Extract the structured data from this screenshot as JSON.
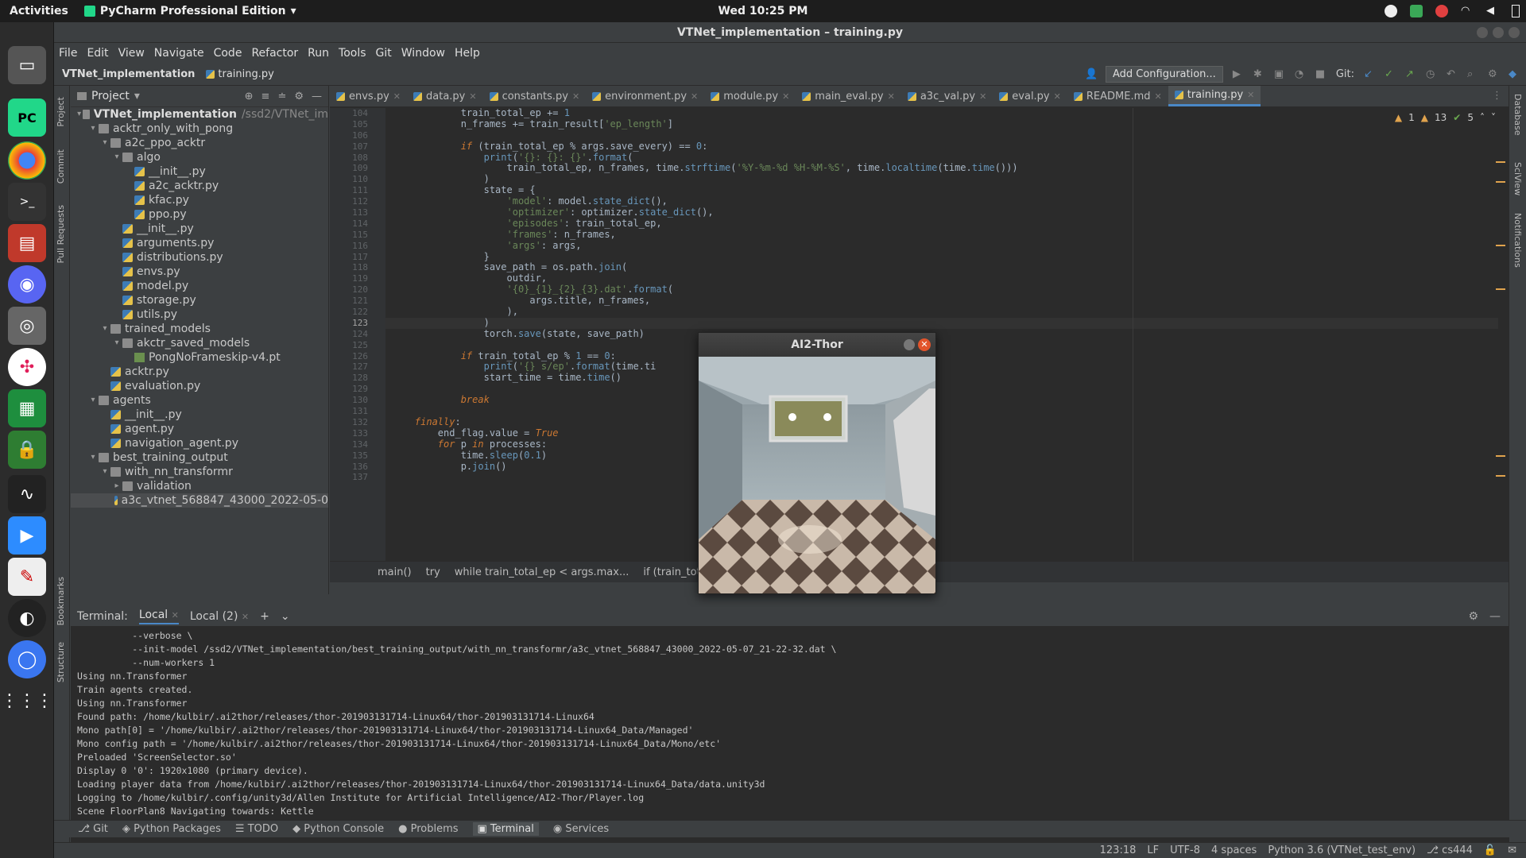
{
  "topbar": {
    "activities": "Activities",
    "app_name": "PyCharm Professional Edition",
    "clock": "Wed 10:25 PM"
  },
  "window": {
    "title": "VTNet_implementation – training.py"
  },
  "menu": [
    "File",
    "Edit",
    "View",
    "Navigate",
    "Code",
    "Refactor",
    "Run",
    "Tools",
    "Git",
    "Window",
    "Help"
  ],
  "navbar": {
    "project": "VTNet_implementation",
    "file": "training.py",
    "add_config": "Add Configuration...",
    "git_label": "Git:"
  },
  "project_panel": {
    "title": "Project",
    "tree": [
      {
        "label": "VTNet_implementation",
        "sub": "/ssd2/VTNet_im",
        "depth": 0,
        "type": "folder",
        "open": true,
        "bold": true
      },
      {
        "label": "acktr_only_with_pong",
        "depth": 1,
        "type": "folder",
        "open": true
      },
      {
        "label": "a2c_ppo_acktr",
        "depth": 2,
        "type": "folder",
        "open": true
      },
      {
        "label": "algo",
        "depth": 3,
        "type": "folder",
        "open": true
      },
      {
        "label": "__init__.py",
        "depth": 4,
        "type": "py"
      },
      {
        "label": "a2c_acktr.py",
        "depth": 4,
        "type": "py"
      },
      {
        "label": "kfac.py",
        "depth": 4,
        "type": "py"
      },
      {
        "label": "ppo.py",
        "depth": 4,
        "type": "py"
      },
      {
        "label": "__init__.py",
        "depth": 3,
        "type": "py"
      },
      {
        "label": "arguments.py",
        "depth": 3,
        "type": "py"
      },
      {
        "label": "distributions.py",
        "depth": 3,
        "type": "py"
      },
      {
        "label": "envs.py",
        "depth": 3,
        "type": "py"
      },
      {
        "label": "model.py",
        "depth": 3,
        "type": "py"
      },
      {
        "label": "storage.py",
        "depth": 3,
        "type": "py"
      },
      {
        "label": "utils.py",
        "depth": 3,
        "type": "py"
      },
      {
        "label": "trained_models",
        "depth": 2,
        "type": "folder",
        "open": true
      },
      {
        "label": "akctr_saved_models",
        "depth": 3,
        "type": "folder",
        "open": true
      },
      {
        "label": "PongNoFrameskip-v4.pt",
        "depth": 4,
        "type": "pt"
      },
      {
        "label": "acktr.py",
        "depth": 2,
        "type": "py"
      },
      {
        "label": "evaluation.py",
        "depth": 2,
        "type": "py"
      },
      {
        "label": "agents",
        "depth": 1,
        "type": "folder",
        "open": true
      },
      {
        "label": "__init__.py",
        "depth": 2,
        "type": "py"
      },
      {
        "label": "agent.py",
        "depth": 2,
        "type": "py"
      },
      {
        "label": "navigation_agent.py",
        "depth": 2,
        "type": "py"
      },
      {
        "label": "best_training_output",
        "depth": 1,
        "type": "folder",
        "open": true
      },
      {
        "label": "with_nn_transformr",
        "depth": 2,
        "type": "folder",
        "open": true
      },
      {
        "label": "validation",
        "depth": 3,
        "type": "folder",
        "open": false
      },
      {
        "label": "a3c_vtnet_568847_43000_2022-05-0",
        "depth": 3,
        "type": "py",
        "selected": true
      }
    ]
  },
  "editor": {
    "tabs": [
      {
        "label": "envs.py"
      },
      {
        "label": "data.py"
      },
      {
        "label": "constants.py"
      },
      {
        "label": "environment.py"
      },
      {
        "label": "module.py"
      },
      {
        "label": "main_eval.py"
      },
      {
        "label": "a3c_val.py"
      },
      {
        "label": "eval.py"
      },
      {
        "label": "README.md"
      },
      {
        "label": "training.py",
        "active": true
      }
    ],
    "inspections": {
      "warn1": "1",
      "warn2": "13",
      "ok": "5"
    },
    "line_numbers": [
      "104",
      "105",
      "106",
      "107",
      "108",
      "109",
      "110",
      "111",
      "112",
      "113",
      "114",
      "115",
      "116",
      "117",
      "118",
      "119",
      "120",
      "121",
      "122",
      "123",
      "124",
      "125",
      "126",
      "127",
      "128",
      "129",
      "130",
      "131",
      "132",
      "133",
      "134",
      "135",
      "136",
      "137"
    ],
    "breadcrumbs": [
      "main()",
      "try",
      "while train_total_ep < args.max...",
      "if (train_total_ep % args.save_..."
    ]
  },
  "popup": {
    "title": "AI2-Thor"
  },
  "terminal": {
    "label": "Terminal:",
    "tabs": [
      "Local",
      "Local (2)"
    ],
    "lines": [
      "          --verbose \\",
      "          --init-model /ssd2/VTNet_implementation/best_training_output/with_nn_transformr/a3c_vtnet_568847_43000_2022-05-07_21-22-32.dat \\",
      "          --num-workers 1",
      "Using nn.Transformer",
      "Train agents created.",
      "Using nn.Transformer",
      "Found path: /home/kulbir/.ai2thor/releases/thor-201903131714-Linux64/thor-201903131714-Linux64",
      "Mono path[0] = '/home/kulbir/.ai2thor/releases/thor-201903131714-Linux64/thor-201903131714-Linux64_Data/Managed'",
      "Mono config path = '/home/kulbir/.ai2thor/releases/thor-201903131714-Linux64/thor-201903131714-Linux64_Data/Mono/etc'",
      "Preloaded 'ScreenSelector.so'",
      "Display 0 '0': 1920x1080 (primary device).",
      "Loading player data from /home/kulbir/.ai2thor/releases/thor-201903131714-Linux64/thor-201903131714-Linux64_Data/data.unity3d",
      "Logging to /home/kulbir/.config/unity3d/Allen Institute for Artificial Intelligence/AI2-Thor/Player.log",
      "Scene FloorPlan8 Navigating towards: Kettle"
    ]
  },
  "bottom_tools": [
    "Git",
    "Python Packages",
    "TODO",
    "Python Console",
    "Problems",
    "Terminal",
    "Services"
  ],
  "statusbar": {
    "position": "123:18",
    "line_sep": "LF",
    "encoding": "UTF-8",
    "indent": "4 spaces",
    "interpreter": "Python 3.6 (VTNet_test_env)",
    "branch": "cs444"
  },
  "side_tabs": {
    "left_top": [
      "Project",
      "Commit",
      "Pull Requests"
    ],
    "left_bottom": [
      "Bookmarks",
      "Structure"
    ],
    "right": [
      "Database",
      "SciView",
      "Notifications"
    ]
  }
}
